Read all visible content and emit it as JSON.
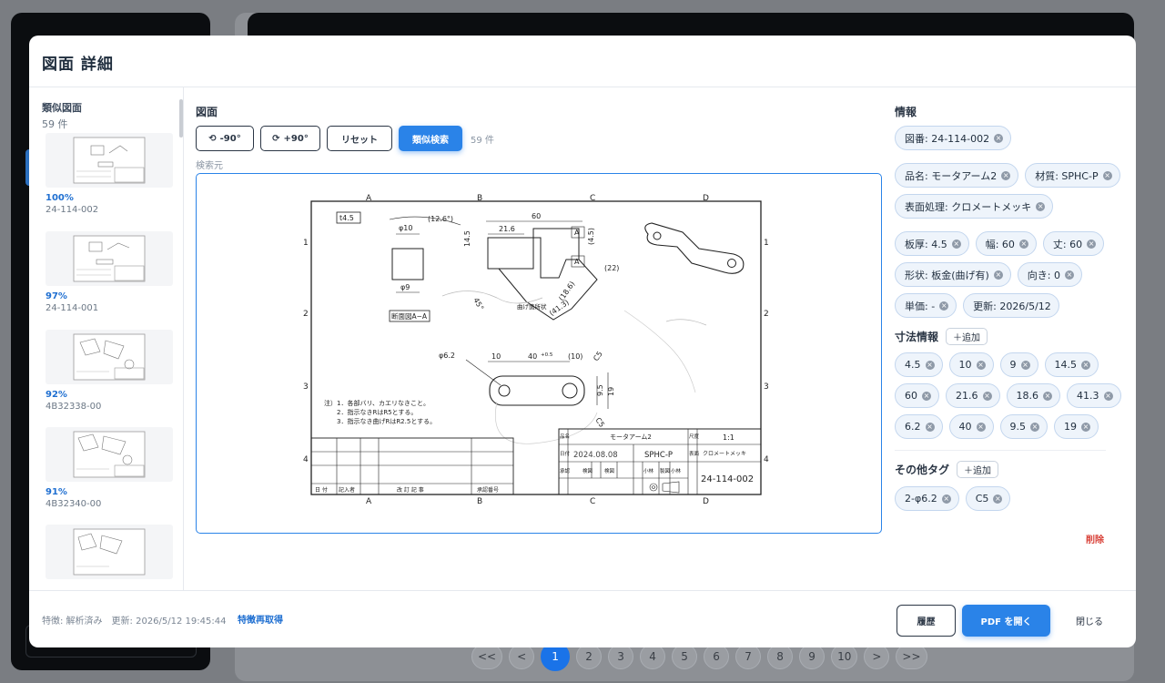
{
  "modal": {
    "title": "図面 詳細"
  },
  "similar": {
    "title": "類似図面",
    "count": "59 件",
    "items": [
      {
        "score": "100%",
        "code": "24-114-002"
      },
      {
        "score": "97%",
        "code": "24-114-001"
      },
      {
        "score": "92%",
        "code": "4B32338-00"
      },
      {
        "score": "91%",
        "code": "4B32340-00"
      },
      {
        "score": "",
        "code": ""
      }
    ]
  },
  "drawing": {
    "title": "図面",
    "rotate_left": "-90°",
    "rotate_right": "+90°",
    "reset": "リセット",
    "search": "類似検索",
    "count": "59 件",
    "source_label": "検索元",
    "sheet": {
      "cols": [
        "A",
        "B",
        "C",
        "D"
      ],
      "rows": [
        "1",
        "2",
        "3",
        "4"
      ],
      "thickness": "t4.5",
      "dims": {
        "phi10": "φ10",
        "angle": "(12.6°)",
        "d60": "60",
        "d21_6": "21.6",
        "d14_5": "14.5",
        "d4_5": "(4.5)",
        "d22": "(22)",
        "phi9": "φ9",
        "a45": "45°",
        "d18_6": "(18.6)",
        "d41_3": "(41.3)",
        "phi6_2": "φ6.2",
        "d10": "10",
        "d40": "40",
        "tol": "+0.5",
        "d10b": "(10)",
        "c5": "C5",
        "c5b": "C5",
        "d9_5": "9.5",
        "d19": "19",
        "secA": "A",
        "secA2": "A"
      },
      "section_label": "断面図A−A",
      "bend_label": "曲げ箇所状",
      "notes": [
        "注）1．各部バリ、カエリなきこと。",
        "2．指示なきRはR5とする。",
        "3．指示なき曲げRはR2.5とする。"
      ],
      "revision_cols": [
        "日 付",
        "記入者",
        "改 訂 記 事",
        "承認番号"
      ],
      "title_block": {
        "part_label": "品名",
        "part": "モータアーム2",
        "scale_label": "尺度",
        "scale": "1:1",
        "date_label": "日付",
        "date": "2024.08.08",
        "material": "SPHC-P",
        "surface_label": "表面",
        "surface": "クロメートメッキ",
        "approve": "承認",
        "check": "検図",
        "check2": "検図",
        "draw1": "製図",
        "draw2": "小林",
        "drawing_no": "24-114-002",
        "small1": "小林",
        "small2": "小林"
      }
    }
  },
  "info": {
    "title": "情報",
    "chips": [
      "図番: 24-114-002",
      "品名: モータアーム2",
      "材質: SPHC-P",
      "表面処理: クロメートメッキ",
      "板厚: 4.5",
      "幅: 60",
      "丈: 60",
      "形状: 板金(曲げ有)",
      "向き: 0",
      "単価: -",
      "更新: 2026/5/12"
    ],
    "dims_title": "寸法情報",
    "add_label": "＋追加",
    "dims": [
      "4.5",
      "10",
      "9",
      "14.5",
      "60",
      "21.6",
      "18.6",
      "41.3",
      "6.2",
      "40",
      "9.5",
      "19"
    ],
    "tags_title": "その他タグ",
    "tags": [
      "2-φ6.2",
      "C5"
    ],
    "delete": "削除"
  },
  "footer": {
    "status": "特徴: 解析済み　更新: 2026/5/12 19:45:44",
    "refresh": "特徴再取得",
    "history": "履歴",
    "open_pdf": "PDF を開く",
    "close": "閉じる"
  },
  "pager": {
    "pages": [
      "<<",
      "<",
      "1",
      "2",
      "3",
      "4",
      "5",
      "6",
      "7",
      "8",
      "9",
      "10",
      ">",
      ">>"
    ],
    "active": "1"
  },
  "colors": {
    "primary": "#2a83e8",
    "danger": "#d9433a",
    "chip_bg": "#eef4fb"
  }
}
